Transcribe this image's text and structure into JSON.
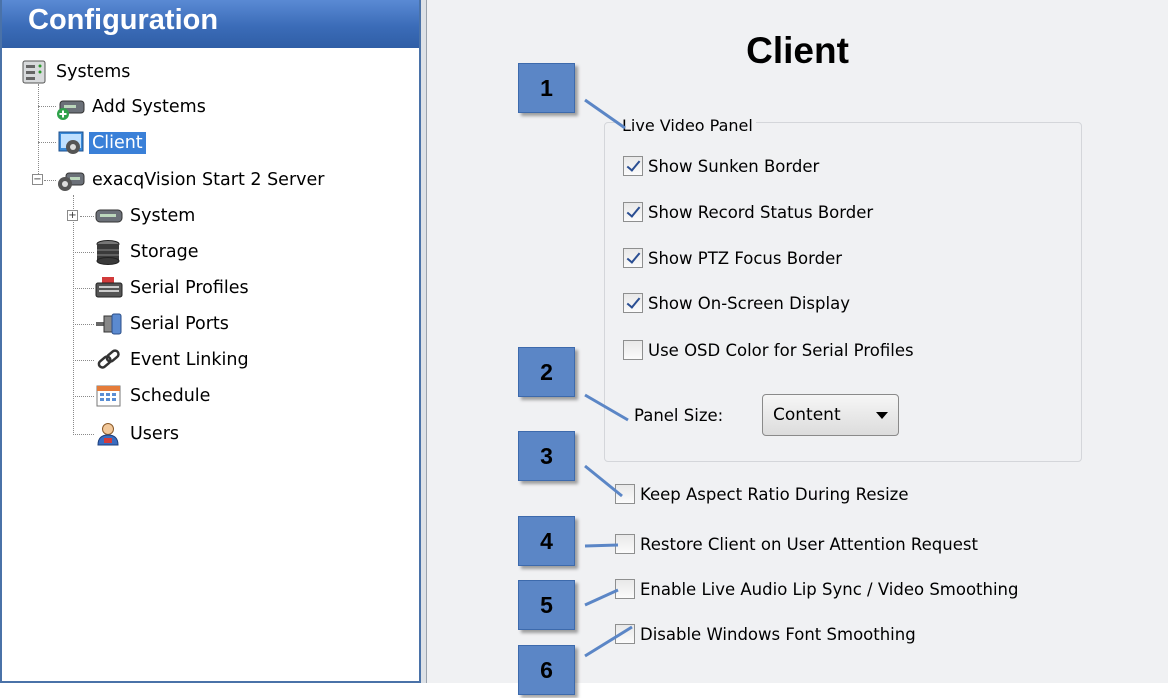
{
  "sidebar": {
    "title": "Configuration",
    "items": [
      {
        "label": "Systems",
        "icon": "server-stack-icon"
      },
      {
        "label": "Add Systems",
        "icon": "add-system-icon"
      },
      {
        "label": "Client",
        "icon": "client-gear-icon",
        "selected": true
      },
      {
        "label": "exacqVision Start 2 Server",
        "icon": "server-gear-icon",
        "expanded": true
      },
      {
        "label": "System",
        "icon": "system-device-icon",
        "collapsed": true
      },
      {
        "label": "Storage",
        "icon": "storage-icon"
      },
      {
        "label": "Serial Profiles",
        "icon": "serial-profiles-icon"
      },
      {
        "label": "Serial Ports",
        "icon": "serial-ports-icon"
      },
      {
        "label": "Event Linking",
        "icon": "event-linking-icon"
      },
      {
        "label": "Schedule",
        "icon": "schedule-icon"
      },
      {
        "label": "Users",
        "icon": "users-icon"
      }
    ]
  },
  "main": {
    "title": "Client",
    "live_video_panel": {
      "legend": "Live Video Panel",
      "options": [
        {
          "label": "Show Sunken Border",
          "checked": true
        },
        {
          "label": "Show Record Status Border",
          "checked": true
        },
        {
          "label": "Show PTZ Focus Border",
          "checked": true
        },
        {
          "label": "Show On-Screen Display",
          "checked": true
        },
        {
          "label": "Use OSD Color for Serial Profiles",
          "checked": false
        }
      ],
      "panel_size_label": "Panel Size:",
      "panel_size_value": "Content"
    },
    "other_options": [
      {
        "label": "Keep Aspect Ratio During Resize",
        "checked": false
      },
      {
        "label": "Restore Client on User Attention Request",
        "checked": false
      },
      {
        "label": "Enable Live Audio Lip Sync / Video Smoothing",
        "checked": false
      },
      {
        "label": "Disable Windows Font Smoothing",
        "checked": false
      }
    ]
  },
  "callouts": [
    "1",
    "2",
    "3",
    "4",
    "5",
    "6"
  ],
  "colors": {
    "header_blue": "#3b6cb8",
    "selection_blue": "#3a80d8",
    "callout_blue": "#5b86c6"
  }
}
